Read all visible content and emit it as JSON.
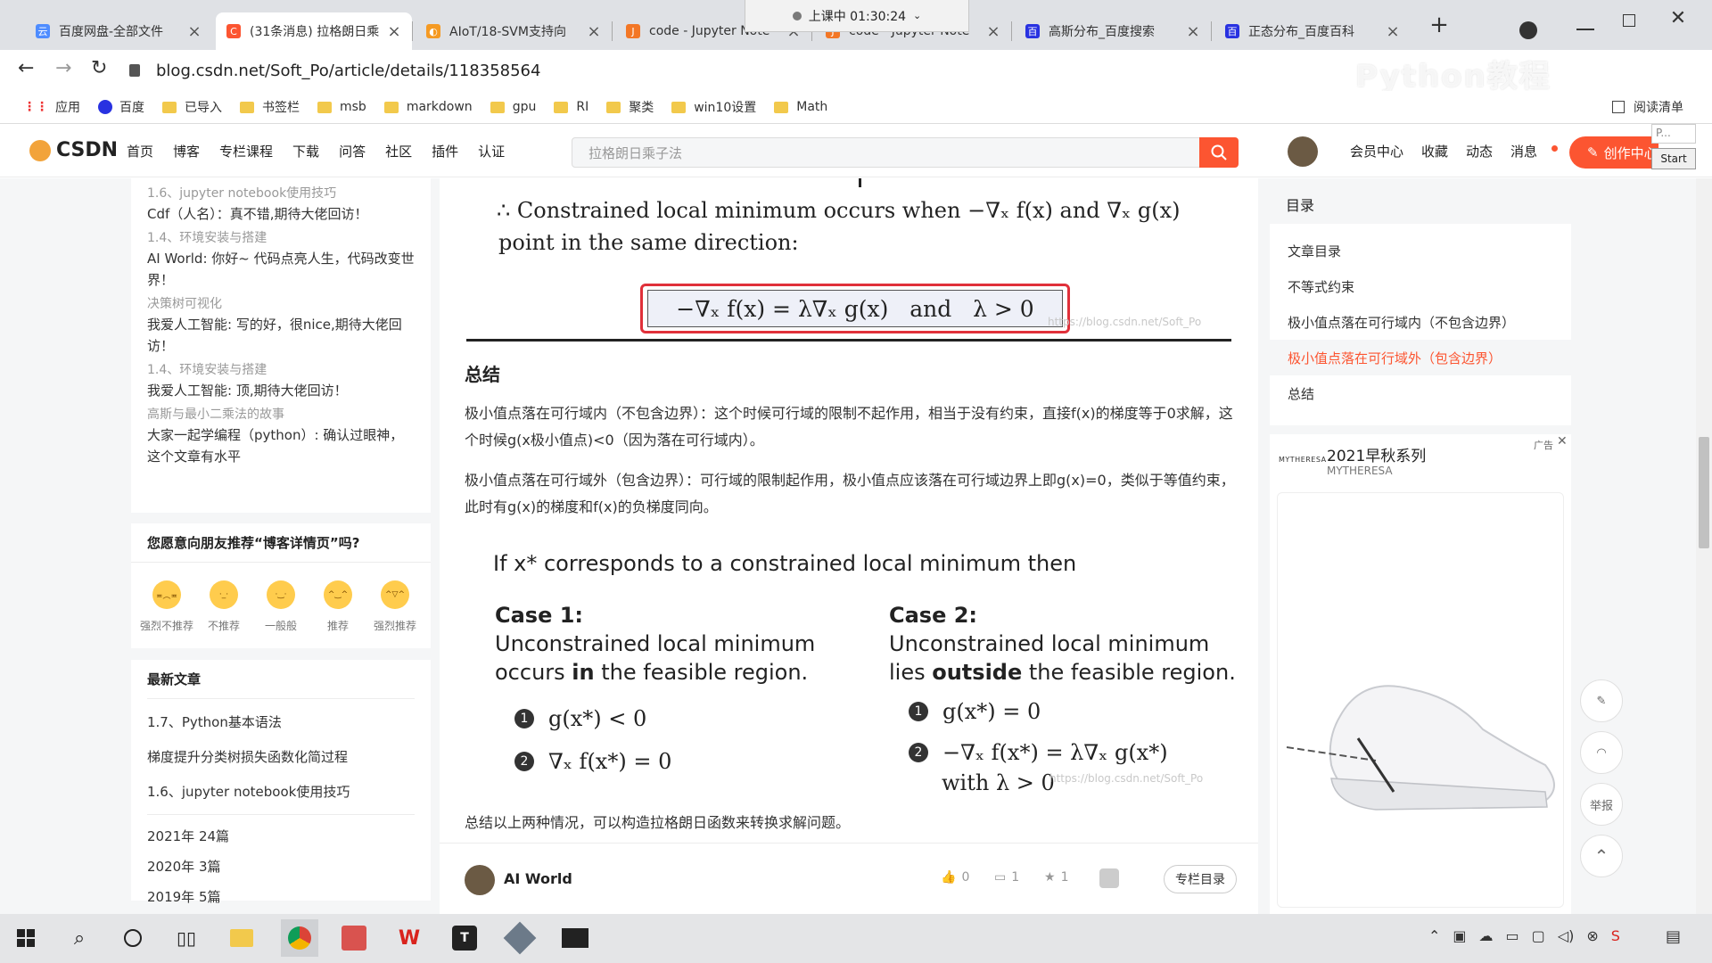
{
  "browser": {
    "tabs": [
      {
        "title": "百度网盘-全部文件",
        "color": "#4e8cff",
        "glyph": "云"
      },
      {
        "title": "(31条消息) 拉格朗日乘",
        "color": "#fc5531",
        "glyph": "C"
      },
      {
        "title": "AIoT/18-SVM支持向",
        "color": "#f59a23",
        "glyph": "◐"
      },
      {
        "title": "code - Jupyter Note",
        "color": "#f37726",
        "glyph": "J"
      },
      {
        "title": "code - Jupyter Note",
        "color": "#f37726",
        "glyph": "J"
      },
      {
        "title": "高斯分布_百度搜索",
        "color": "#2932e1",
        "glyph": "百"
      },
      {
        "title": "正态分布_百度百科",
        "color": "#2932e1",
        "glyph": "百"
      }
    ],
    "recording": "上课中 01:30:24",
    "url": "blog.csdn.net/Soft_Po/article/details/118358564",
    "bookmarks": [
      "应用",
      "百度",
      "已导入",
      "书签栏",
      "msb",
      "markdown",
      "gpu",
      "RI",
      "聚类",
      "win10设置",
      "Math"
    ],
    "reading_list": "阅读清单",
    "watermark": "Python教程",
    "start_label": "Start",
    "mini_label": "P..."
  },
  "csdn": {
    "logo": "CSDN",
    "nav": [
      "首页",
      "博客",
      "专栏课程",
      "下载",
      "问答",
      "社区",
      "插件",
      "认证"
    ],
    "search_placeholder": "拉格朗日乘子法",
    "right_nav": [
      "会员中心",
      "收藏",
      "动态",
      "消息"
    ],
    "create": "创作中心"
  },
  "left": {
    "comments": [
      {
        "title": "1.6、jupyter notebook使用技巧",
        "text": "Cdf（人名）：真不错,期待大佬回访！"
      },
      {
        "title": "1.4、环境安装与搭建",
        "text": "AI World: 你好~ 代码点亮人生，代码改变世界！"
      },
      {
        "title": "决策树可视化",
        "text": "我爱人工智能: 写的好，很nice,期待大佬回访！"
      },
      {
        "title": "1.4、环境安装与搭建",
        "text": "我爱人工智能: 顶,期待大佬回访！"
      },
      {
        "title": "高斯与最小二乘法的故事",
        "text": "大家一起学编程（python）: 确认过眼神，这个文章有水平"
      }
    ],
    "recommend_title": "您愿意向朋友推荐“博客详情页”吗?",
    "ratings": [
      "强烈不推荐",
      "不推荐",
      "一般般",
      "推荐",
      "强烈推荐"
    ],
    "latest_title": "最新文章",
    "latest": [
      "1.7、Python基本语法",
      "梯度提升分类树损失函数化简过程",
      "1.6、jupyter notebook使用技巧"
    ],
    "archive": [
      "2021年 24篇",
      "2020年 3篇",
      "2019年 5篇"
    ]
  },
  "article": {
    "therefore": "∴ Constrained local minimum occurs when −∇ₓ f(x) and ∇ₓ g(x)",
    "therefore_2": "point in the same direction:",
    "formula": "−∇ₓ f(x) = λ∇ₓ g(x)   and   λ > 0",
    "watermark1": "https://blog.csdn.net/Soft_Po",
    "summary_title": "总结",
    "para1": "极小值点落在可行域内（不包含边界）：这个时候可行域的限制不起作用，相当于没有约束，直接f(x)的梯度等于0求解，这个时候g(x极小值点)<0（因为落在可行域内）。",
    "para2": "极小值点落在可行域外（包含边界）：可行域的限制起作用，极小值点应该落在可行域边界上即g(x)=0，类似于等值约束，此时有g(x)的梯度和f(x)的负梯度同向。",
    "if_line": "If x* corresponds to a constrained local minimum then",
    "case1_title": "Case 1:",
    "case1_l1": "Unconstrained local minimum",
    "case1_l2a": "occurs ",
    "case1_l2b": "in",
    "case1_l2c": " the feasible region.",
    "case1_eq1": "g(x*) < 0",
    "case1_eq2": "∇ₓ f(x*) = 0",
    "case2_title": "Case 2:",
    "case2_l1": "Unconstrained local minimum",
    "case2_l2a": "lies ",
    "case2_l2b": "outside",
    "case2_l2c": " the feasible region.",
    "case2_eq1": "g(x*) = 0",
    "case2_eq2": "−∇ₓ f(x*) = λ∇ₓ g(x*)",
    "case2_eq3": "with λ > 0",
    "watermark2": "https://blog.csdn.net/Soft_Po",
    "conclusion": "总结以上两种情况，可以构造拉格朗日函数来转换求解问题。",
    "author": "AI World",
    "likes": "0",
    "comments": "1",
    "favorites": "1",
    "column_btn": "专栏目录"
  },
  "toc": {
    "title": "目录",
    "items": [
      "文章目录",
      "不等式约束",
      "极小值点落在可行域内（不包含边界）",
      "极小值点落在可行域外（包含边界）",
      "总结"
    ],
    "active_index": 3
  },
  "ad": {
    "label": "广告",
    "title": "2021早秋系列",
    "brand": "MYTHERESA",
    "logo": "MYTHERESA"
  },
  "side_tools": [
    "举报"
  ],
  "colors": {
    "accent": "#fc5531",
    "formula_border": "#e0303a"
  }
}
